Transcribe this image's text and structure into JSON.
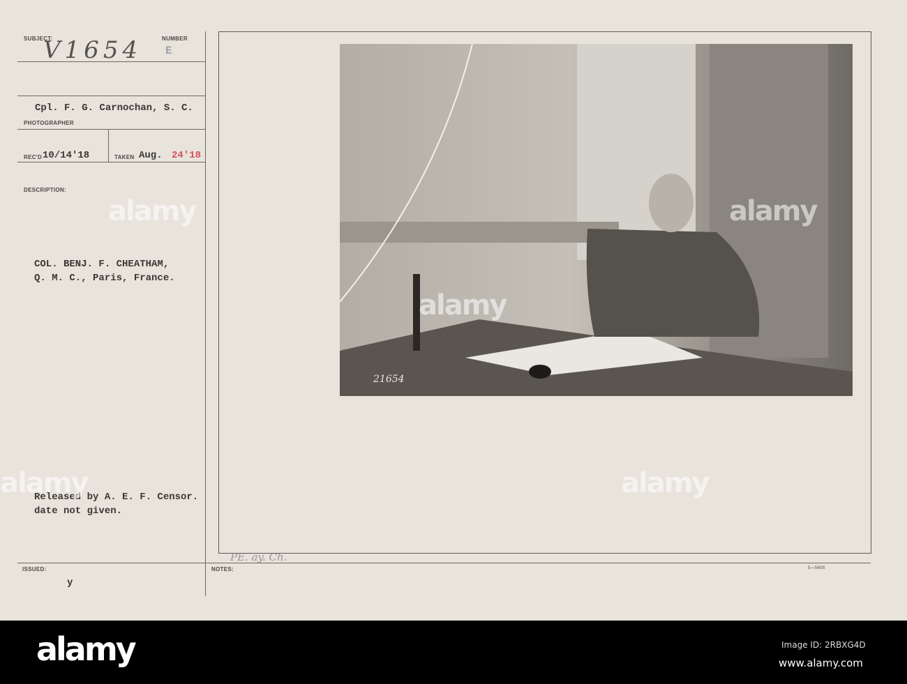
{
  "card": {
    "subject_label": "SUBJECT:",
    "subject_value": "V1654",
    "number_label": "NUMBER",
    "number_value": "E",
    "photographer_name": "Cpl. F. G. Carnochan, S. C.",
    "photographer_label": "PHOTOGRAPHER",
    "received_label": "REC'D",
    "received_value": "10/14'18",
    "taken_label": "TAKEN",
    "taken_month": "Aug.",
    "taken_day": "24'18",
    "description_label": "DESCRIPTION:",
    "description_line1": "COL. BENJ. F. CHEATHAM,",
    "description_line2": "Q. M. C., Paris, France.",
    "censor_line1": "Released by A. E. F. Censor.",
    "censor_line2": "date not given.",
    "issued_label": "ISSUED:",
    "issued_value": "y",
    "notes_label": "NOTES:",
    "notes_handwritten": "PE. ay. Ch.",
    "form_number": "5—5605",
    "photo_number": "21654"
  },
  "watermark": {
    "brand": "alamy",
    "image_id": "Image ID: 2RBXG4D",
    "url": "www.alamy.com"
  }
}
